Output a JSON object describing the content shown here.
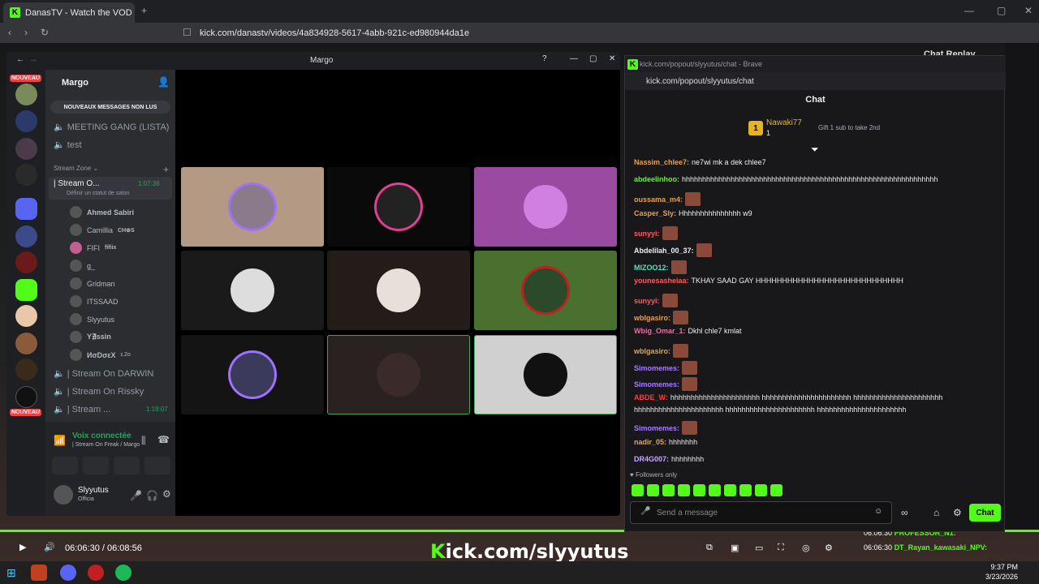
{
  "browser": {
    "tab_title": "DanasTV - Watch the VOD on Ki",
    "url": "kick.com/danastv/videos/4a834928-5617-4abb-921c-ed980944da1e"
  },
  "player": {
    "time": "06:06:30 / 06:08:56",
    "brand_prefix": "K",
    "brand_text": "ick.com/slyyutus",
    "side_title": "Chat Replay",
    "side_rows": [
      {
        "time": "06:06:30",
        "user": "PROFESSOR_N1:"
      },
      {
        "time": "06:06:30",
        "user": "DT_Rayan_kawasaki_NPV:"
      }
    ]
  },
  "discord": {
    "window_title": "Margo",
    "server_name": "Margo",
    "new_badge": "NOUVEAU",
    "new_messages": "NOUVEAUX MESSAGES NON LUS",
    "channels": [
      "MEETING GANG (LISTA)",
      "test"
    ],
    "category": "Stream Zone",
    "active_channel": "| Stream O...",
    "active_timer": "1:07:36",
    "status_hint": "Définir un statut de salon",
    "members": [
      {
        "name": "Ahmed Sabiri",
        "tag": ""
      },
      {
        "name": "Camillia",
        "tag": "CH⊕S"
      },
      {
        "name": "FIFI",
        "tag": "fifiix"
      },
      {
        "name": "g_",
        "tag": ""
      },
      {
        "name": "Gridman",
        "tag": ""
      },
      {
        "name": "ITSSAAD",
        "tag": ""
      },
      {
        "name": "Slyyutus",
        "tag": ""
      },
      {
        "name": "Y∄ssin",
        "tag": ""
      },
      {
        "name": "ИσDσεX",
        "tag": "ɪ.2ᴏ"
      }
    ],
    "other_channels": [
      {
        "name": "| Stream On DARWIN",
        "timer": ""
      },
      {
        "name": "| Stream On Rissky",
        "timer": ""
      },
      {
        "name": "| Stream ...",
        "timer": "1:19:07"
      }
    ],
    "voice_status": "Voix connectée",
    "voice_channel": "| Stream On Freak / Margo",
    "user_name": "Slyyutus",
    "user_status": "Officia"
  },
  "kick": {
    "window_title": "kick.com/popout/slyyutus/chat - Brave",
    "url": "kick.com/popout/slyyutus/chat",
    "header": "Chat",
    "gifter": {
      "name": "Nawaki77",
      "count": "1",
      "rank": "1",
      "note": "Gift 1 sub to take 2nd"
    },
    "messages": [
      {
        "user": "Nassim_chlee7",
        "color": "#e6a14f",
        "text": "ne7wi mk a dek chlee7",
        "emote": false
      },
      {
        "user": "abdeelinhoo",
        "color": "#53fc18",
        "text": "hhhhhhhhhhhhhhhhhhhhhhhhhhhhhhhhhhhhhhhhhhhhhhhhhhhhhhhhhhhhhhh",
        "emote": false
      },
      {
        "user": "oussama_m4",
        "color": "#e6a14f",
        "text": "",
        "emote": true
      },
      {
        "user": "Casper_Sly",
        "color": "#e6a14f",
        "text": "Hhhhhhhhhhhhhhh w9",
        "emote": false
      },
      {
        "user": "sunyyi",
        "color": "#ff5a5a",
        "text": "",
        "emote": true
      },
      {
        "user": "Abdelilah_00_37",
        "color": "#efeff1",
        "text": "",
        "emote": true
      },
      {
        "user": "MIZOO12",
        "color": "#4fe3c1",
        "text": "",
        "emote": true
      },
      {
        "user": "younesasheiaa",
        "color": "#ff5a5a",
        "text": "TKHAY SAAD GAY HHHHHHHHHHHHHHHHHHHHHHHHHHHH",
        "emote": false
      },
      {
        "user": "sunyyi",
        "color": "#ff5a5a",
        "text": "",
        "emote": true
      },
      {
        "user": "wblgasiro",
        "color": "#e6a14f",
        "text": "",
        "emote": true
      },
      {
        "user": "Wbig_Omar_1",
        "color": "#e66fa0",
        "text": "Dkhl chle7 kmlat",
        "emote": false
      },
      {
        "user": "wblgasiro",
        "color": "#e6a14f",
        "text": "",
        "emote": true
      },
      {
        "user": "Simomemes",
        "color": "#a77bff",
        "text": "",
        "emote": true
      },
      {
        "user": "Simomemes",
        "color": "#a77bff",
        "text": "",
        "emote": true
      },
      {
        "user": "ABDE_W",
        "color": "#ff3b3b",
        "text": "hhhhhhhhhhhhhhhhhhhhhh hhhhhhhhhhhhhhhhhhhhhh hhhhhhhhhhhhhhhhhhhhhh",
        "emote": false
      },
      {
        "user": "",
        "color": "#efeff1",
        "text": "hhhhhhhhhhhhhhhhhhhhhh hhhhhhhhhhhhhhhhhhhhhh hhhhhhhhhhhhhhhhhhhhhh",
        "emote": false
      },
      {
        "user": "Simomemes",
        "color": "#a77bff",
        "text": "",
        "emote": true
      },
      {
        "user": "nadir_05",
        "color": "#e6a14f",
        "text": "hhhhhhh",
        "emote": false
      },
      {
        "user": "DR4G007",
        "color": "#c8a8ff",
        "text": "hhhhhhhh",
        "emote": false
      }
    ],
    "followers_only": "Followers only",
    "input_placeholder": "Send a message",
    "chat_button": "Chat"
  },
  "taskbar": {
    "time": "9:37 PM",
    "date": "3/23/2026"
  }
}
